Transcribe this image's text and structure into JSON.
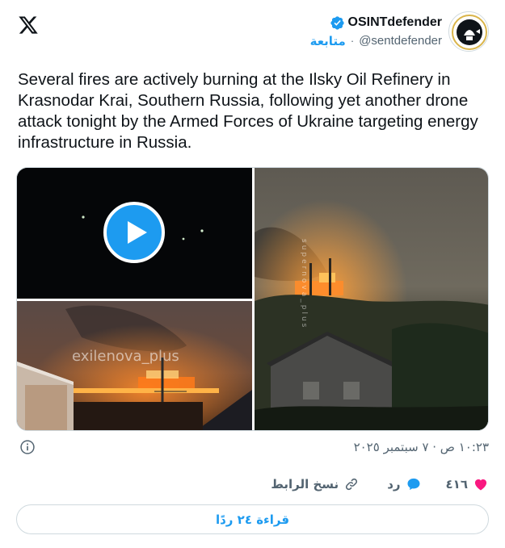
{
  "author": {
    "display_name": "OSINTdefender",
    "handle": "@sentdefender",
    "follow_label": "متابعة",
    "separator": "·"
  },
  "tweet": {
    "text": "Several fires are actively burning at the Ilsky Oil Refinery in Krasnodar Krai, Southern Russia, following yet another drone attack tonight by the Armed Forces of Ukraine targeting energy infrastructure in Russia."
  },
  "media": {
    "watermark_left": "exilenova_plus",
    "watermark_right": "supernova_plus"
  },
  "meta": {
    "timestamp": "١٠:٢٣ ص · ٧ سبتمبر ٢٠٢٥"
  },
  "actions": {
    "likes_count": "٤١٦",
    "reply_label": "رد",
    "copy_link_label": "نسخ الرابط"
  },
  "read_replies_label": "قراءة ٢٤ ردًا",
  "colors": {
    "accent": "#1d9bf0",
    "like": "#f91880",
    "muted": "#536471"
  }
}
